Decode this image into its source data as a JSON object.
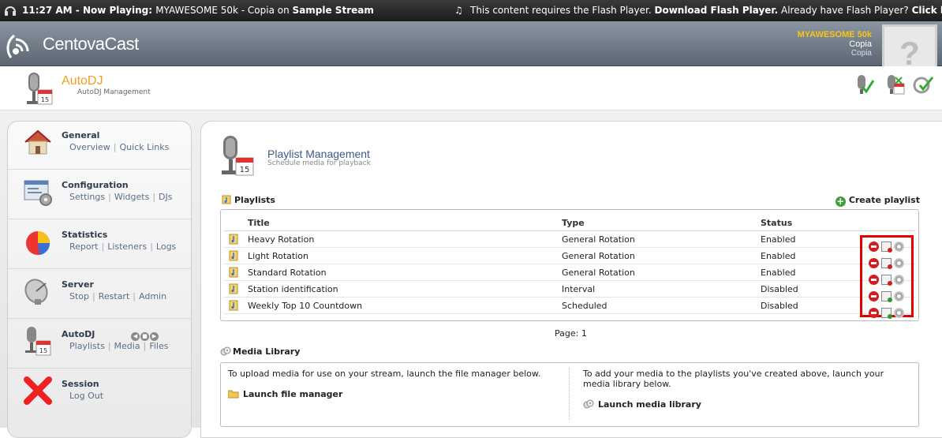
{
  "topbar": {
    "time": "11:27 AM",
    "now_playing_prefix": " - Now Playing: ",
    "track": "MYAWESOME 50k - Copia",
    "on_text": " on ",
    "stream": "Sample Stream",
    "flash_text": "This content requires the Flash Player.",
    "download_flash": "Download Flash Player.",
    "already_have": "Already have Flash Player?",
    "click_here": "Click here."
  },
  "header": {
    "logo_text": "CentovaCast",
    "station_name": "MYAWESOME 50k",
    "station_user": "Copia",
    "station_sub": "Copia",
    "avatar_glyph": "?"
  },
  "pagehead": {
    "title": "AutoDJ",
    "subtitle": "AutoDJ Management"
  },
  "sidebar": {
    "items": [
      {
        "title": "General",
        "links": [
          "Overview",
          "Quick Links"
        ]
      },
      {
        "title": "Configuration",
        "links": [
          "Settings",
          "Widgets",
          "DJs"
        ]
      },
      {
        "title": "Statistics",
        "links": [
          "Report",
          "Listeners",
          "Logs"
        ]
      },
      {
        "title": "Server",
        "links": [
          "Stop",
          "Restart",
          "Admin"
        ]
      },
      {
        "title": "AutoDJ",
        "links": [
          "Playlists",
          "Media",
          "Files"
        ]
      },
      {
        "title": "Session",
        "links": [
          "Log Out"
        ]
      }
    ]
  },
  "main": {
    "title": "Playlist Management",
    "subtitle": "Schedule media for playback",
    "playlists_label": "Playlists",
    "create_label": "Create playlist",
    "columns": [
      "Title",
      "Type",
      "Status"
    ],
    "rows": [
      {
        "title": "Heavy Rotation",
        "type": "General Rotation",
        "status": "Enabled"
      },
      {
        "title": "Light Rotation",
        "type": "General Rotation",
        "status": "Enabled"
      },
      {
        "title": "Standard Rotation",
        "type": "General Rotation",
        "status": "Enabled"
      },
      {
        "title": "Station identification",
        "type": "Interval",
        "status": "Disabled"
      },
      {
        "title": "Weekly Top 10 Countdown",
        "type": "Scheduled",
        "status": "Disabled"
      }
    ],
    "pager": "Page: 1",
    "media_label": "Media Library",
    "media_left_text": "To upload media for use on your stream, launch the file manager below.",
    "media_left_link": "Launch file manager",
    "media_right_text": "To add your media to the playlists you've created above, launch your media library below.",
    "media_right_link": "Launch media library"
  },
  "colors": {
    "accent_orange": "#f0a020",
    "station_yellow": "#f5c518",
    "link_blue": "#5a6f8a",
    "highlight_red": "#e00000"
  }
}
